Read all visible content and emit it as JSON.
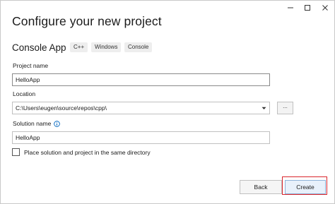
{
  "window": {
    "controls": {
      "minimize": "minimize-icon",
      "maximize": "maximize-icon",
      "close": "close-icon"
    }
  },
  "page": {
    "title": "Configure your new project",
    "template_name": "Console App",
    "tags": [
      "C++",
      "Windows",
      "Console"
    ]
  },
  "form": {
    "project_name": {
      "label": "Project name",
      "value": "HelloApp"
    },
    "location": {
      "label": "Location",
      "value": "C:\\Users\\eugen\\source\\repos\\cpp\\",
      "browse_label": "..."
    },
    "solution_name": {
      "label": "Solution name",
      "value": "HelloApp",
      "info_icon": "info-icon"
    },
    "same_directory": {
      "label": "Place solution and project in the same directory",
      "checked": false
    }
  },
  "footer": {
    "back_label": "Back",
    "create_label": "Create"
  },
  "colors": {
    "highlight": "#d9242c",
    "accent": "#0067c0"
  }
}
